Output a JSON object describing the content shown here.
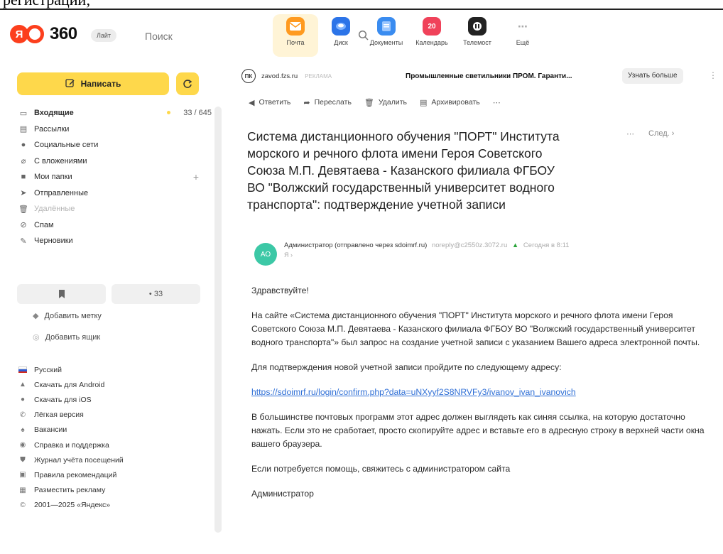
{
  "caption": {
    "text": "регистрации;"
  },
  "header": {
    "brand": "360",
    "plan": "Лайт",
    "search_placeholder": "Поиск",
    "apps": [
      {
        "label": "Почта",
        "color": "#ff9a1f",
        "icon": "mail-icon",
        "active": true
      },
      {
        "label": "Диск",
        "color": "#2c74e8",
        "icon": "disk-icon",
        "active": false
      },
      {
        "label": "Документы",
        "color": "#3a8cf0",
        "icon": "docs-icon",
        "active": false
      },
      {
        "label": "Календарь",
        "color": "#f0425a",
        "icon": "calendar-icon",
        "badge": "20",
        "active": false
      },
      {
        "label": "Телемост",
        "color": "#222222",
        "icon": "telemost-icon",
        "active": false
      },
      {
        "label": "Ещё",
        "color": "#ffffff",
        "icon": "more-icon",
        "active": false
      }
    ]
  },
  "sidebar": {
    "compose_label": "Написать",
    "folders": [
      {
        "label": "Входящие",
        "icon": "inbox-icon",
        "count": "33 / 645"
      },
      {
        "label": "Рассылки",
        "icon": "newsletter-icon"
      },
      {
        "label": "Социальные сети",
        "icon": "social-icon"
      },
      {
        "label": "С вложениями",
        "icon": "attachment-icon"
      },
      {
        "label": "Мои папки",
        "icon": "folder-icon"
      },
      {
        "label": "Отправленные",
        "icon": "sent-icon"
      },
      {
        "label": "Удалённые",
        "icon": "trash-icon"
      },
      {
        "label": "Спам",
        "icon": "spam-icon"
      },
      {
        "label": "Черновики",
        "icon": "drafts-icon"
      }
    ],
    "unread_count": "• 33",
    "add_label": "Добавить метку",
    "add_mailbox": "Добавить ящик",
    "footer": [
      {
        "label": "Русский",
        "icon": "flag-icon"
      },
      {
        "label": "Скачать для Android",
        "icon": "android-icon"
      },
      {
        "label": "Скачать для iOS",
        "icon": "apple-icon"
      },
      {
        "label": "Лёгкая версия",
        "icon": "phone-icon"
      },
      {
        "label": "Вакансии",
        "icon": "vacancy-icon"
      },
      {
        "label": "Справка и поддержка",
        "icon": "help-icon"
      },
      {
        "label": "Журнал учёта посещений",
        "icon": "shield-icon"
      },
      {
        "label": "Правила рекомендаций",
        "icon": "rules-icon"
      },
      {
        "label": "Разместить рекламу",
        "icon": "ads-icon"
      },
      {
        "label": "2001—2025 «Яндекс»",
        "icon": "copyright-icon"
      }
    ]
  },
  "ad": {
    "logo": "ПК",
    "domain": "zavod.fzs.ru",
    "tag": "РЕКЛАМА",
    "title": "Промышленные светильники ПРОМ. Гаранти...",
    "button": "Узнать больше"
  },
  "toolbar": {
    "reply": "Ответить",
    "forward": "Переслать",
    "delete": "Удалить",
    "archive": "Архивировать"
  },
  "message": {
    "subject": "Система дистанционного обучения \"ПОРТ\" Института морского и речного флота имени Героя Советского Союза М.П. Девятаева - Казанского филиала ФГБОУ ВО \"Волжский государственный университет водного транспорта\": подтверждение учетной записи",
    "next_label": "След.",
    "avatar_initials": "АО",
    "sender": "Администратор (отправлено через sdoimrf.ru)",
    "sender_email": "noreply@c2550z.3072.ru",
    "date": "Сегодня в 8:11",
    "to": "Я",
    "greeting": "Здравствуйте!",
    "para1": "На сайте «Система дистанционного обучения \"ПОРТ\" Института морского и речного флота имени Героя Советского Союза М.П. Девятаева - Казанского филиала ФГБОУ ВО \"Волжский государственный университет водного транспорта\"» был запрос на создание учетной записи с указанием Вашего адреса электронной почты.",
    "para2": "Для подтверждения новой учетной записи пройдите по следующему адресу:",
    "link": "https://sdoimrf.ru/login/confirm.php?data=uNXyyf2S8NRVFy3/ivanov_ivan_ivanovich",
    "para3": "В большинстве почтовых программ этот адрес должен выглядеть как синяя ссылка, на которую достаточно нажать. Если это не сработает, просто скопируйте адрес и вставьте его в адресную строку в верхней части окна вашего браузера.",
    "para4": "Если потребуется помощь, свяжитесь с администратором сайта",
    "signature": "Администратор"
  }
}
